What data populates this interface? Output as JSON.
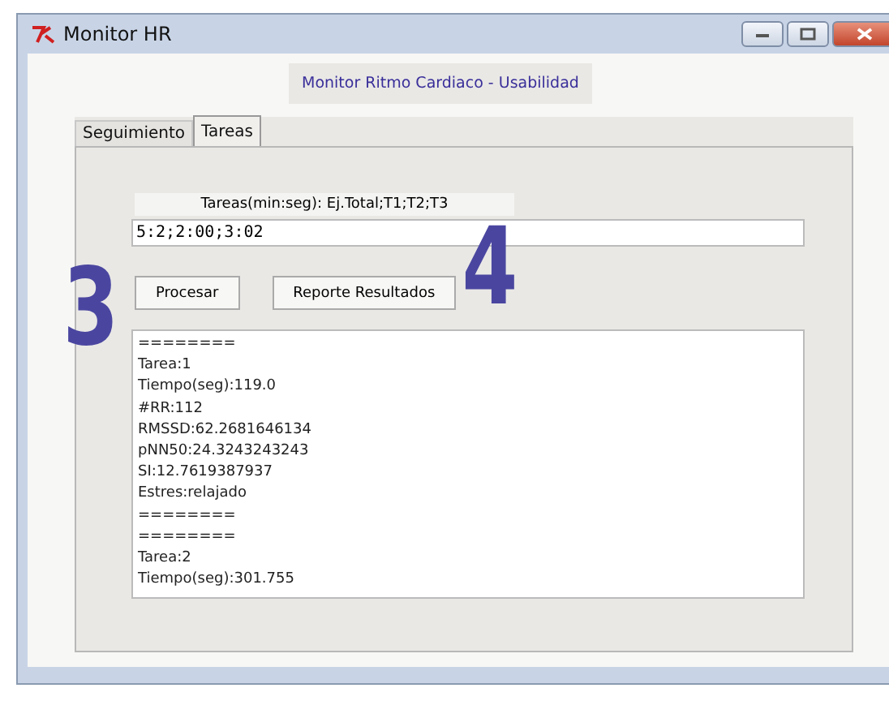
{
  "window": {
    "title": "Monitor HR"
  },
  "header": {
    "title": "Monitor Ritmo Cardiaco - Usabilidad"
  },
  "tabs": [
    {
      "label": "Seguimiento",
      "selected": false
    },
    {
      "label": "Tareas",
      "selected": true
    }
  ],
  "tasks_field": {
    "label": "Tareas(min:seg): Ej.Total;T1;T2;T3",
    "value": "5:2;2:00;3:02"
  },
  "buttons": [
    "Procesar",
    "Reporte Resultados"
  ],
  "output_lines": [
    "========",
    "Tarea:1",
    "Tiempo(seg):119.0",
    "#RR:112",
    "RMSSD:62.2681646134",
    "pNN50:24.3243243243",
    "SI:12.7619387937",
    "Estres:relajado",
    "========",
    "========",
    "Tarea:2",
    "Tiempo(seg):301.755"
  ],
  "callouts": [
    "3",
    "4"
  ]
}
